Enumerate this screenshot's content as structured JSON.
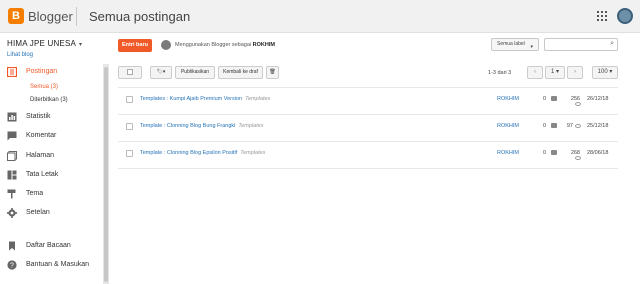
{
  "header": {
    "brand": "Blogger",
    "page_title": "Semua postingan"
  },
  "sidebar": {
    "blog_name": "HIMA JPE UNESA",
    "view_blog": "Lihat blog",
    "items": [
      {
        "label": "Postingan",
        "icon": "posts-icon"
      },
      {
        "label": "Statistik",
        "icon": "stats-icon"
      },
      {
        "label": "Komentar",
        "icon": "comments-icon"
      },
      {
        "label": "Halaman",
        "icon": "pages-icon"
      },
      {
        "label": "Tata Letak",
        "icon": "layout-icon"
      },
      {
        "label": "Tema",
        "icon": "theme-icon"
      },
      {
        "label": "Setelan",
        "icon": "settings-icon"
      },
      {
        "label": "Daftar Bacaan",
        "icon": "reading-list-icon"
      },
      {
        "label": "Bantuan & Masukan",
        "icon": "help-icon"
      }
    ],
    "sub_items": [
      {
        "label": "Semua (3)"
      },
      {
        "label": "Diterbitkan (3)"
      }
    ]
  },
  "main": {
    "new_post": "Entri baru",
    "author_prefix": "Menggunakan Blogger sebagai",
    "author_name": "ROKHIM",
    "label_filter": "Semua label",
    "search_placeholder": "",
    "toolbar": {
      "publish": "Publikasikan",
      "revert": "Kembali ke draf"
    },
    "pagination": {
      "range": "1-3 dari 3",
      "page": "1",
      "per_page": "100"
    },
    "posts": [
      {
        "title": "Templates : Kumpi Ajaib Premium Version",
        "label": "Templates",
        "author": "ROKHIM",
        "comments": "0",
        "views": "256",
        "date": "26/12/18"
      },
      {
        "title": "Template : Clonning Blog Bung Frangki",
        "label": "Templates",
        "author": "ROKHIM",
        "comments": "0",
        "views": "97",
        "date": "25/12/18"
      },
      {
        "title": "Template : Clonning Blog Epsilon Positif",
        "label": "Templates",
        "author": "ROKHIM",
        "comments": "0",
        "views": "268",
        "date": "28/06/18"
      }
    ]
  },
  "colors": {
    "accent": "#f05a28",
    "link": "#2673b8",
    "brand": "#f57d00"
  }
}
